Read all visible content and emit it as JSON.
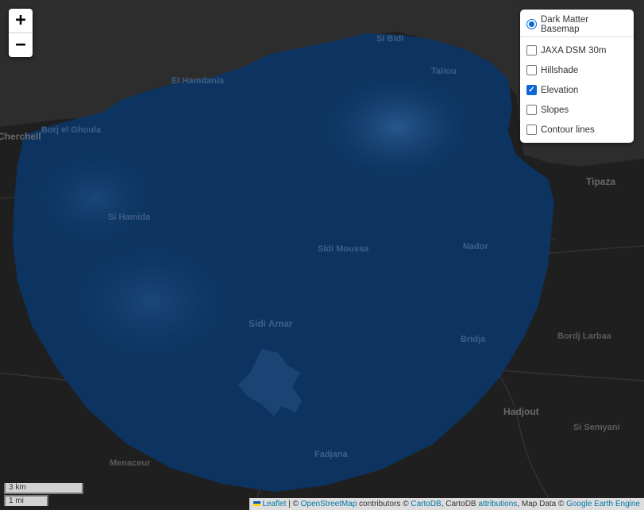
{
  "map": {
    "places": [
      "El Hamdania",
      "Si Bidi",
      "Taliou",
      "Borj el Ghoula",
      "Cherchell",
      "Tipaza",
      "Si Hamida",
      "Sidi Moussa",
      "Nador",
      "Sidi Amar",
      "Bordj Larbaa",
      "Bridja",
      "Hadjout",
      "Si Semyani",
      "Menaceur",
      "Fadjana"
    ]
  },
  "colors": {
    "background": "#262626",
    "land": "#1f1f1f",
    "sea": "#2d2d2d",
    "elevation_overlay": "#0c3563",
    "control_accent": "#0b66d6"
  },
  "zoom": {
    "in_label": "+",
    "out_label": "−"
  },
  "layers": {
    "basemap": {
      "label": "Dark Matter Basemap",
      "selected": true
    },
    "overlays": [
      {
        "label": "JAXA DSM 30m",
        "checked": false
      },
      {
        "label": "Hillshade",
        "checked": false
      },
      {
        "label": "Elevation",
        "checked": true
      },
      {
        "label": "Slopes",
        "checked": false
      },
      {
        "label": "Contour lines",
        "checked": false
      }
    ]
  },
  "scale": {
    "metric": "3 km",
    "imperial": "1 mi"
  },
  "attribution": {
    "leaflet": "Leaflet",
    "sep1": " | © ",
    "osm": "OpenStreetMap",
    "text1": " contributors © ",
    "cartodb": "CartoDB",
    "text2": ", CartoDB ",
    "attributions": "attributions",
    "text3": ", Map Data © ",
    "gee": "Google Earth Engine"
  }
}
